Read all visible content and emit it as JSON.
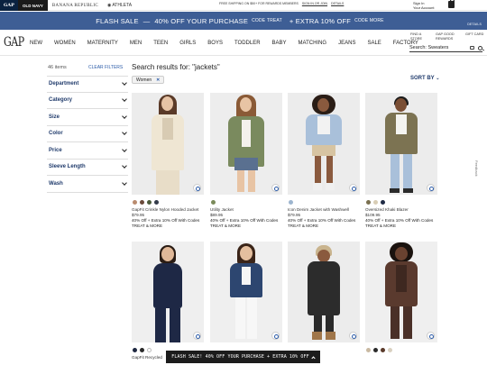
{
  "brand_tabs": [
    "GAP",
    "OLD NAVY",
    "BANANA REPUBLIC",
    "ATHLETA"
  ],
  "top_promo": {
    "text": "FREE SHIPPING ON $50+ FOR REWARDS MEMBERS",
    "signin": "SIGN IN OR JOIN",
    "details": "DETAILS"
  },
  "account": {
    "line1": "Sign In",
    "line2": "Your Account"
  },
  "flash": {
    "lead": "FLASH SALE",
    "offer": "40% OFF YOUR PURCHASE",
    "code1": "CODE TREAT",
    "extra": "+ EXTRA 10% OFF",
    "code2": "CODE MORE",
    "details": "DETAILS"
  },
  "nav": {
    "logo": "GAP",
    "items": [
      "NEW",
      "WOMEN",
      "MATERNITY",
      "MEN",
      "TEEN",
      "GIRLS",
      "BOYS",
      "TODDLER",
      "BABY",
      "MATCHING",
      "JEANS",
      "SALE",
      "FACTORY"
    ],
    "find_store": [
      "FIND A",
      "STORE"
    ],
    "rewards": [
      "GAP GOOD",
      "REWARDS"
    ],
    "gift_card": "GIFT CARD",
    "search_value": "Search: Sweaters"
  },
  "filters": {
    "count": "46 items",
    "clear": "CLEAR FILTERS",
    "groups": [
      "Department",
      "Category",
      "Size",
      "Color",
      "Price",
      "Sleeve Length",
      "Wash"
    ]
  },
  "results": {
    "title": "Search results for: \"jackets\"",
    "chip": "Women",
    "chip_remove": "✕",
    "sort": "SORT BY"
  },
  "feedback": "Feedback",
  "products": [
    {
      "name": "GapFit Crinkle Nylon Hooded Jacket",
      "price": "$79.95",
      "offer": "40% Off + Extra 10% Off With Codes",
      "treat": "TREAT & MORE",
      "swatches": [
        "#b98b6e",
        "#6b4a3a",
        "#4a5a3a",
        "#333b4a"
      ]
    },
    {
      "name": "Utility Jacket",
      "price": "$89.95",
      "offer": "40% Off + Extra 10% Off With Codes",
      "treat": "TREAT & MORE",
      "swatches": [
        "#7a8a5a"
      ]
    },
    {
      "name": "Icon Denim Jacket with Washwell",
      "price": "$79.95",
      "offer": "40% Off + Extra 10% Off With Codes",
      "treat": "TREAT & MORE",
      "swatches": [
        "#9db5cf"
      ]
    },
    {
      "name": "Oversized Khaki Blazer",
      "price": "$109.95",
      "offer": "40% Off + Extra 10% Off With Codes",
      "treat": "TREAT & MORE",
      "swatches": [
        "#7a7050",
        "#d8cdb5",
        "#1e2a44"
      ]
    },
    {
      "name": "GapFit Recycled",
      "price": "",
      "offer": "",
      "treat": "",
      "swatches": [
        "#1e2740",
        "#2a2a2a",
        "#ffffff"
      ]
    },
    {
      "name": "",
      "price": "",
      "offer": "",
      "treat": "",
      "swatches": []
    },
    {
      "name": "",
      "price": "",
      "offer": "",
      "treat": "",
      "swatches": []
    },
    {
      "name": "",
      "price": "",
      "offer": "",
      "treat": "",
      "swatches": [
        "#c9b9a2",
        "#2a2a2a",
        "#5a3a2a",
        "#d9d0c0"
      ]
    }
  ],
  "bottom_promo": "FLASH SALE! 40% OFF YOUR PURCHASE + EXTRA 10% OFF"
}
